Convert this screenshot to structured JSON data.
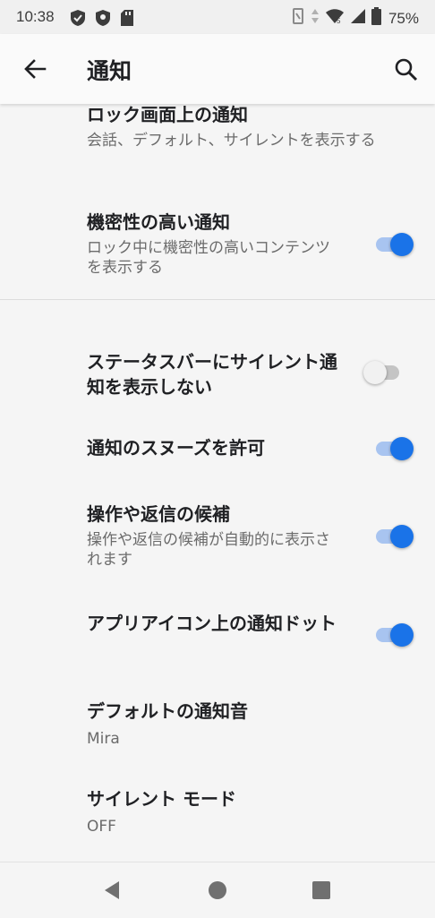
{
  "status_bar": {
    "time": "10:38",
    "battery_percent": "75%",
    "icons_left": [
      "shield-check-icon",
      "shield-icon",
      "sd-card-icon"
    ],
    "icons_right": [
      "vibrate-icon",
      "data-arrows-icon",
      "wifi-icon",
      "cell-signal-icon",
      "battery-icon"
    ]
  },
  "app_bar": {
    "title": "通知",
    "back_icon": "arrow-back-icon",
    "search_icon": "search-icon"
  },
  "settings": [
    {
      "id": "lockscreen",
      "title": "ロック画面上の通知",
      "subtitle": "会話、デフォルト、サイレントを表示する"
    },
    {
      "id": "sensitive",
      "title": "機密性の高い通知",
      "subtitle": "ロック中に機密性の高いコンテンツを表示する",
      "toggle": true
    },
    {
      "id": "silent-statusbar",
      "title": "ステータスバーにサイレント通知を表示しない",
      "toggle": false
    },
    {
      "id": "snooze",
      "title": "通知のスヌーズを許可",
      "toggle": true
    },
    {
      "id": "suggested-actions",
      "title": "操作や返信の候補",
      "subtitle": "操作や返信の候補が自動的に表示されます",
      "toggle": true
    },
    {
      "id": "dots",
      "title": "アプリアイコン上の通知ドット",
      "toggle": true
    },
    {
      "id": "default-sound",
      "title": "デフォルトの通知音",
      "subtitle": "Mira"
    },
    {
      "id": "dnd",
      "title": "サイレント モード",
      "subtitle": "OFF"
    }
  ],
  "colors": {
    "accent": "#1a73e8",
    "accent_track": "#a8c4f0"
  },
  "nav_bar": [
    "back-triangle-icon",
    "home-circle-icon",
    "recents-square-icon"
  ]
}
